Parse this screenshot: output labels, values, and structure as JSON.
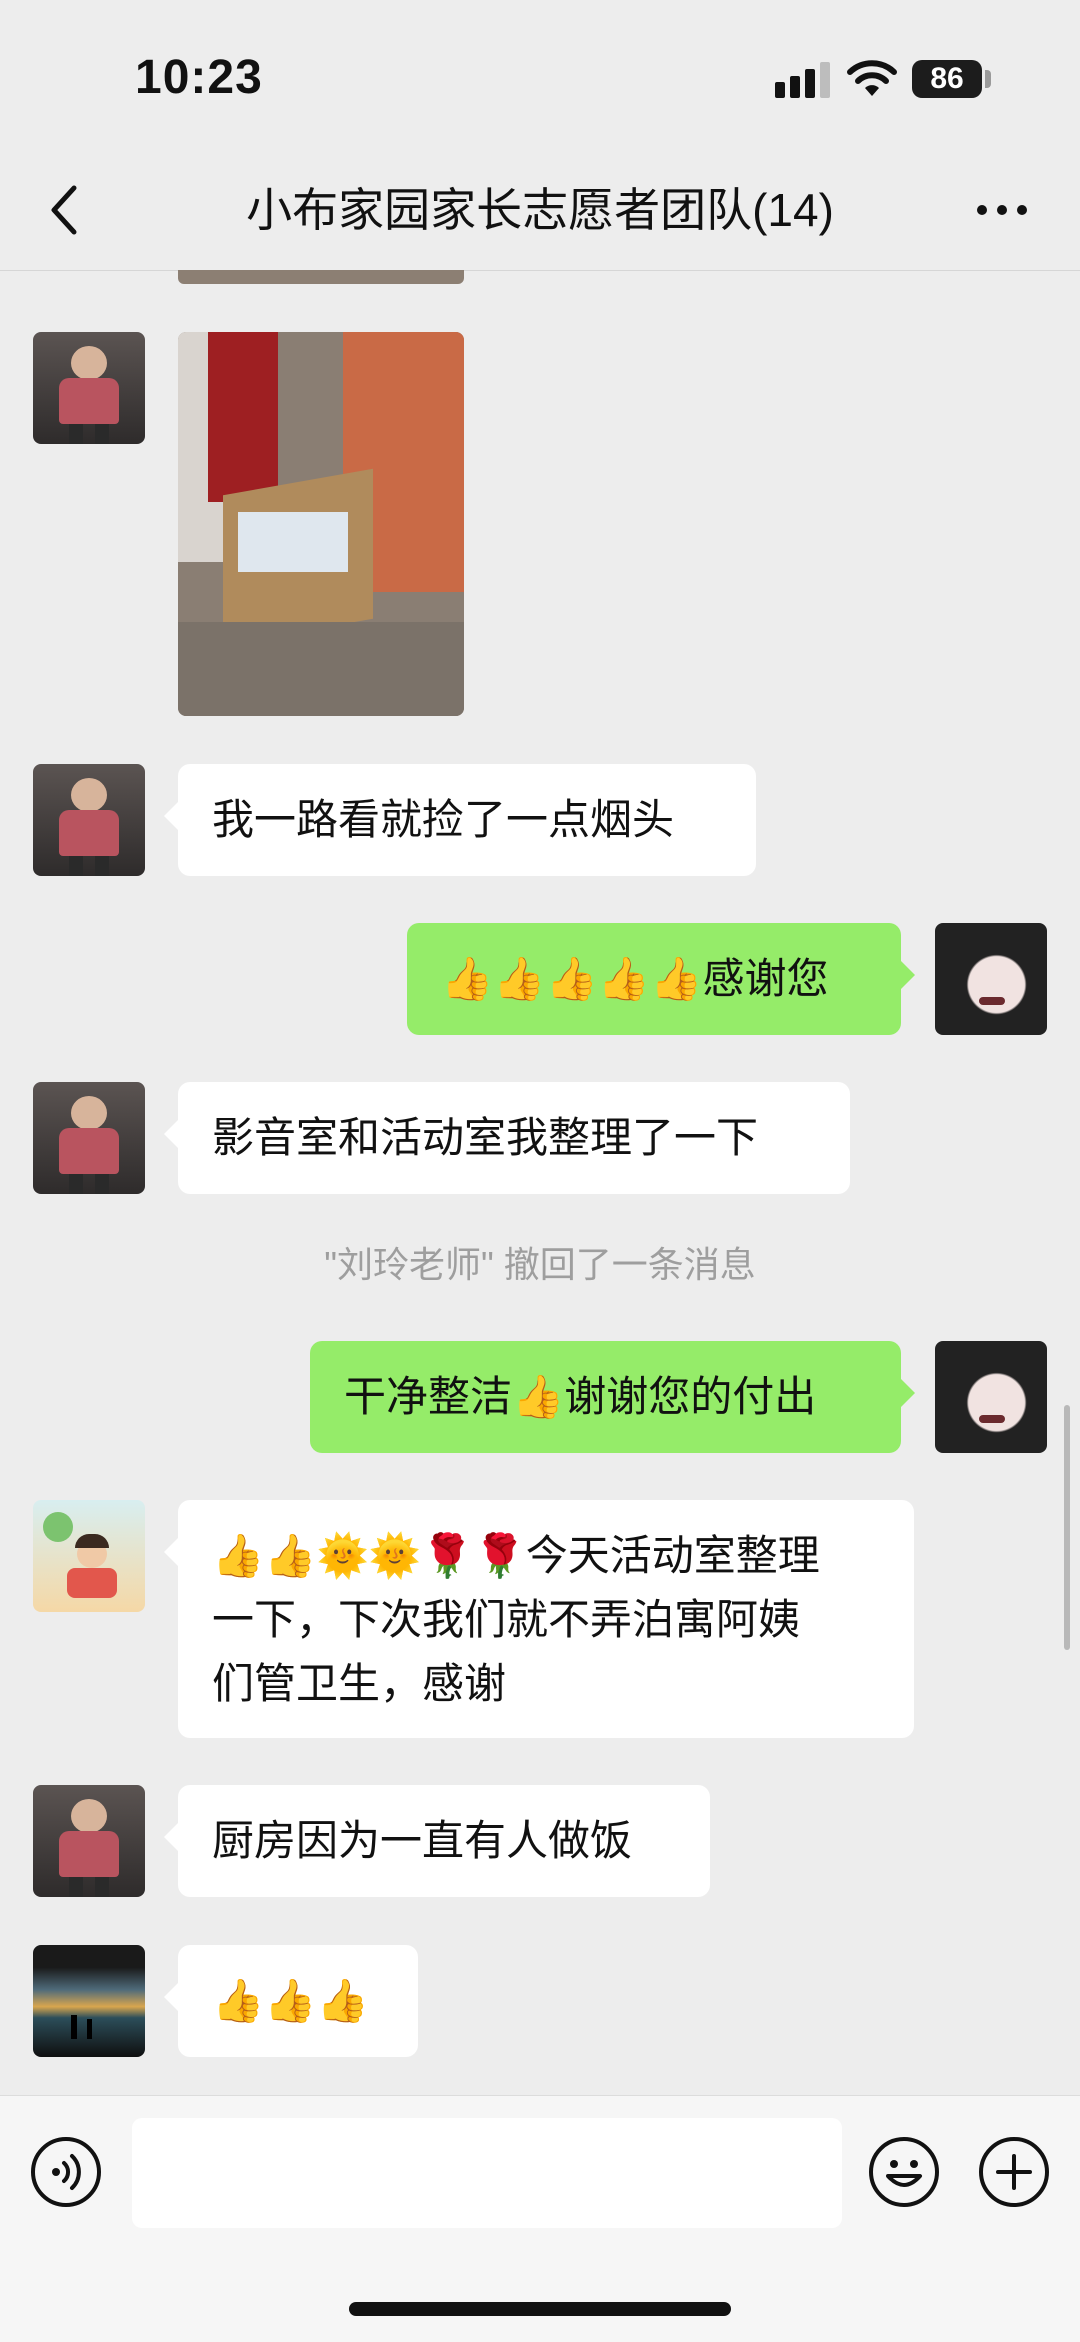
{
  "status_bar": {
    "time": "10:23",
    "battery": "86"
  },
  "chat": {
    "title": "小布家园家长志愿者团队(14)",
    "messages": [
      {
        "side": "left",
        "type": "image",
        "alt": ""
      },
      {
        "side": "left",
        "type": "text",
        "text": "我一路看就捡了一点烟头"
      },
      {
        "side": "right",
        "type": "text",
        "text": "👍👍👍👍👍感谢您"
      },
      {
        "side": "left",
        "type": "text",
        "text": "影音室和活动室我整理了一下"
      },
      {
        "side": "system",
        "type": "system",
        "text": "\"刘玲老师\" 撤回了一条消息"
      },
      {
        "side": "right",
        "type": "text",
        "text": "干净整洁👍谢谢您的付出"
      },
      {
        "side": "left",
        "type": "text",
        "lines": [
          "👍👍🌞🌞🌹🌹今天活动室整理",
          "一下，下次我们就不弄泊寓阿姨",
          "们管卫生，感谢"
        ]
      },
      {
        "side": "left",
        "type": "text",
        "text": "厨房因为一直有人做饭"
      },
      {
        "side": "left",
        "type": "text",
        "text": "👍👍👍"
      }
    ]
  },
  "input": {
    "placeholder": ""
  },
  "colors": {
    "self_bubble": "#95ec69",
    "other_bubble": "#ffffff",
    "background": "#ededed"
  },
  "icons": [
    "back-icon",
    "more-icon",
    "voice-icon",
    "emoji-icon",
    "plus-icon",
    "signal-icon",
    "wifi-icon",
    "battery-icon"
  ]
}
